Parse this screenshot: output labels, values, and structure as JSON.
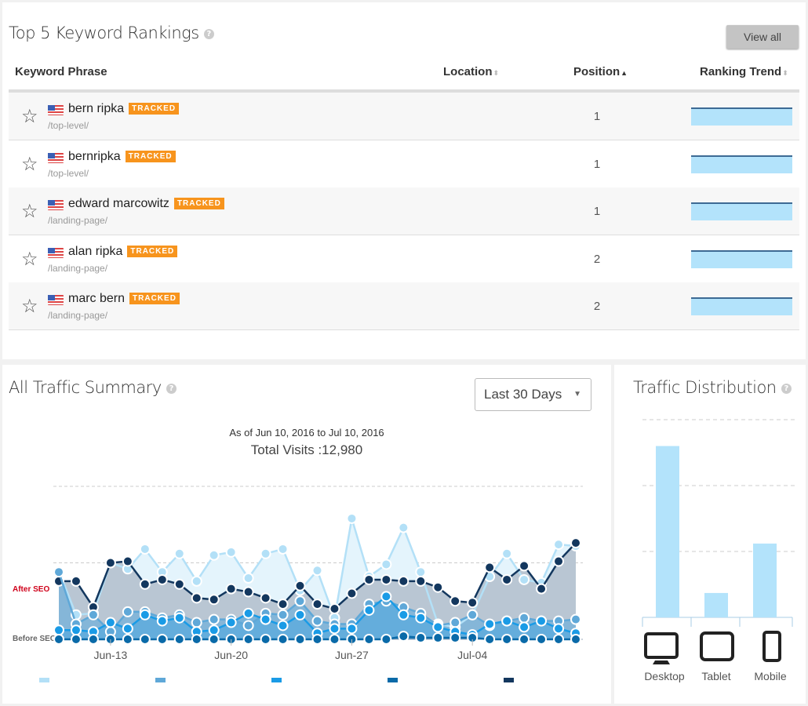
{
  "keywords": {
    "title": "Top 5 Keyword Rankings",
    "help_icon": "question-circle-icon",
    "view_all_label": "View all",
    "columns": {
      "phrase": "Keyword Phrase",
      "location": "Location",
      "position": "Position",
      "trend": "Ranking Trend"
    },
    "sort_state": {
      "position": "ascending"
    },
    "rows": [
      {
        "keyword": "bern ripka",
        "badge": "TRACKED",
        "url": "/top-level/",
        "position": "1"
      },
      {
        "keyword": "bernripka",
        "badge": "TRACKED",
        "url": "/top-level/",
        "position": "1"
      },
      {
        "keyword": "edward marcowitz",
        "badge": "TRACKED",
        "url": "/landing-page/",
        "position": "1"
      },
      {
        "keyword": "alan ripka",
        "badge": "TRACKED",
        "url": "/landing-page/",
        "position": "2"
      },
      {
        "keyword": "marc bern",
        "badge": "TRACKED",
        "url": "/landing-page/",
        "position": "2"
      }
    ],
    "colors": {
      "badge": "#f7941d",
      "sparkline_fill": "#b3e3fb",
      "sparkline_line": "#3d6a94"
    }
  },
  "traffic": {
    "title": "All Traffic Summary",
    "range_select": "Last 30 Days",
    "as_of": "As of Jun 10, 2016 to Jul 10, 2016",
    "total": "Total Visits :12,980",
    "after_label": "After SEO",
    "before_label": "Before SEO"
  },
  "distribution": {
    "title": "Traffic Distribution",
    "labels": [
      "Desktop",
      "Tablet",
      "Mobile"
    ],
    "icons": [
      "desktop-icon",
      "tablet-icon",
      "mobile-icon"
    ]
  },
  "chart_data": [
    {
      "type": "area",
      "x_start": "2016-06-10",
      "x_end": "2016-07-10",
      "x_tick_labels": [
        "Jun-13",
        "Jun-20",
        "Jun-27",
        "Jul-04"
      ],
      "ylim": [
        0,
        100
      ],
      "grid": "dashed horizontal",
      "annotations": [
        "After SEO",
        "Before SEO"
      ],
      "legend": "bottom",
      "series": [
        {
          "color": "#b3e0f7",
          "values": [
            45,
            16,
            17,
            50,
            46,
            59,
            44,
            56,
            38,
            55,
            57,
            40,
            56,
            59,
            32,
            45,
            14,
            79,
            41,
            49,
            73,
            44,
            10,
            8,
            16,
            41,
            56,
            39,
            37,
            62,
            61
          ]
        },
        {
          "color": "#5fa8d8",
          "values": [
            44,
            10,
            16,
            5,
            18,
            18,
            14,
            16,
            11,
            13,
            13,
            9,
            17,
            16,
            25,
            12,
            10,
            10,
            23,
            25,
            21,
            17,
            9,
            11,
            16,
            9,
            12,
            14,
            12,
            12,
            13
          ]
        },
        {
          "color": "#1a9be6",
          "values": [
            6,
            6,
            5,
            11,
            7,
            16,
            12,
            14,
            5,
            6,
            11,
            17,
            13,
            9,
            16,
            4,
            7,
            7,
            19,
            28,
            16,
            14,
            8,
            5,
            3,
            10,
            12,
            8,
            12,
            7,
            4
          ]
        },
        {
          "color": "#0a6aa8",
          "values": [
            0,
            0,
            0,
            0,
            0,
            0,
            0,
            0,
            0,
            0,
            0,
            0,
            0,
            0,
            0,
            0,
            0,
            0,
            0,
            0,
            2,
            1,
            1,
            1,
            1,
            0,
            0,
            0,
            0,
            0,
            0
          ]
        },
        {
          "color": "#13375e",
          "values": [
            38,
            38,
            21,
            50,
            51,
            36,
            39,
            36,
            27,
            26,
            33,
            31,
            27,
            23,
            35,
            23,
            20,
            30,
            39,
            39,
            38,
            38,
            34,
            25,
            24,
            47,
            39,
            48,
            33,
            51,
            63
          ]
        }
      ]
    },
    {
      "type": "bar",
      "categories": [
        "Desktop",
        "Tablet",
        "Mobile"
      ],
      "values": [
        2.6,
        0.37,
        1.12
      ],
      "ylim": [
        0,
        3
      ],
      "grid": "dashed horizontal",
      "color": "#b3e3fb"
    }
  ]
}
